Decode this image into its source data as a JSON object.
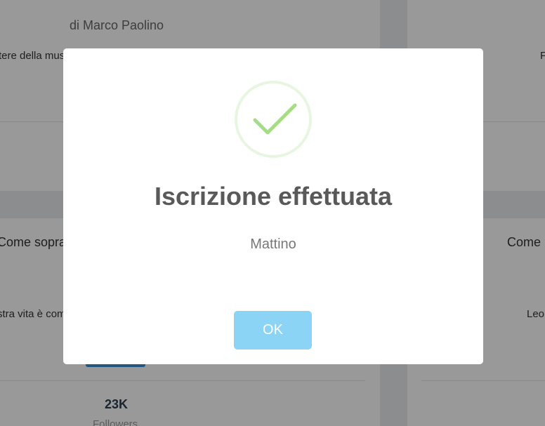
{
  "background": {
    "card_top_left": {
      "author": "di Marco Paolino",
      "description": "tere della mus"
    },
    "card_top_right": {
      "description": "F"
    },
    "card_bottom_left": {
      "title": "Come soprav",
      "description": "stra vita è com",
      "followers_count": "23K",
      "followers_label": "Followers"
    },
    "card_bottom_right": {
      "title": "Come r",
      "description": "Leo"
    }
  },
  "modal": {
    "icon": "success-check-icon",
    "title": "Iscrizione effettuata",
    "text": "Mattino",
    "ok_label": "OK"
  },
  "colors": {
    "success_green": "#a5dc86",
    "button_blue": "#8cd4f5",
    "title_gray": "#595959"
  }
}
